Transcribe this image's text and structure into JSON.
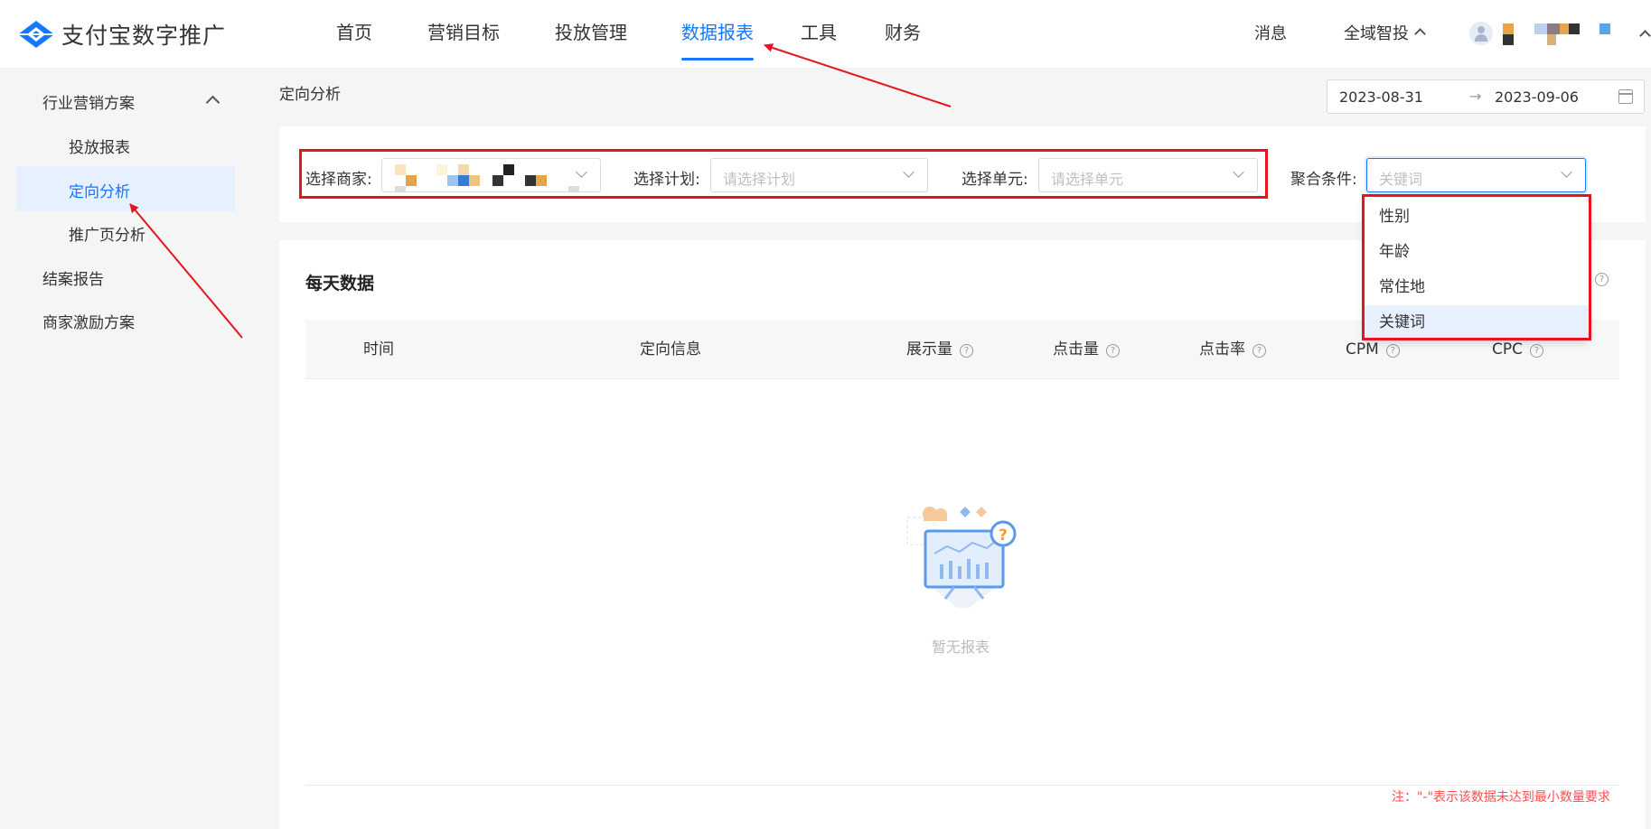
{
  "app": {
    "title": "支付宝数字推广"
  },
  "nav": {
    "items": [
      {
        "label": "首页"
      },
      {
        "label": "营销目标"
      },
      {
        "label": "投放管理"
      },
      {
        "label": "数据报表",
        "active": true
      },
      {
        "label": "工具"
      },
      {
        "label": "财务"
      }
    ],
    "messages": "消息",
    "smart": "全域智投"
  },
  "sidebar": {
    "group": "行业营销方案",
    "sub_items": [
      {
        "label": "投放报表"
      },
      {
        "label": "定向分析",
        "active": true
      },
      {
        "label": "推广页分析"
      }
    ],
    "items": [
      {
        "label": "结案报告"
      },
      {
        "label": "商家激励方案"
      }
    ]
  },
  "page": {
    "title": "定向分析"
  },
  "date_range": {
    "start": "2023-08-31",
    "separator": "→",
    "end": "2023-09-06"
  },
  "filters": {
    "merchant_label": "选择商家:",
    "plan_label": "选择计划:",
    "plan_placeholder": "请选择计划",
    "unit_label": "选择单元:",
    "unit_placeholder": "请选择单元",
    "agg_label": "聚合条件:",
    "agg_value": "关键词"
  },
  "agg_options": [
    {
      "label": "性别"
    },
    {
      "label": "年龄"
    },
    {
      "label": "常住地"
    },
    {
      "label": "关键词",
      "selected": true
    }
  ],
  "report": {
    "title": "每天数据",
    "columns": [
      "时间",
      "定向信息",
      "展示量",
      "点击量",
      "点击率",
      "CPM",
      "CPC"
    ],
    "empty_text": "暂无报表",
    "note": "注：\"-\"表示该数据未达到最小数量要求"
  },
  "colors": {
    "accent": "#1677ff",
    "annotation": "#e6141e",
    "note": "#ff4d4f"
  }
}
